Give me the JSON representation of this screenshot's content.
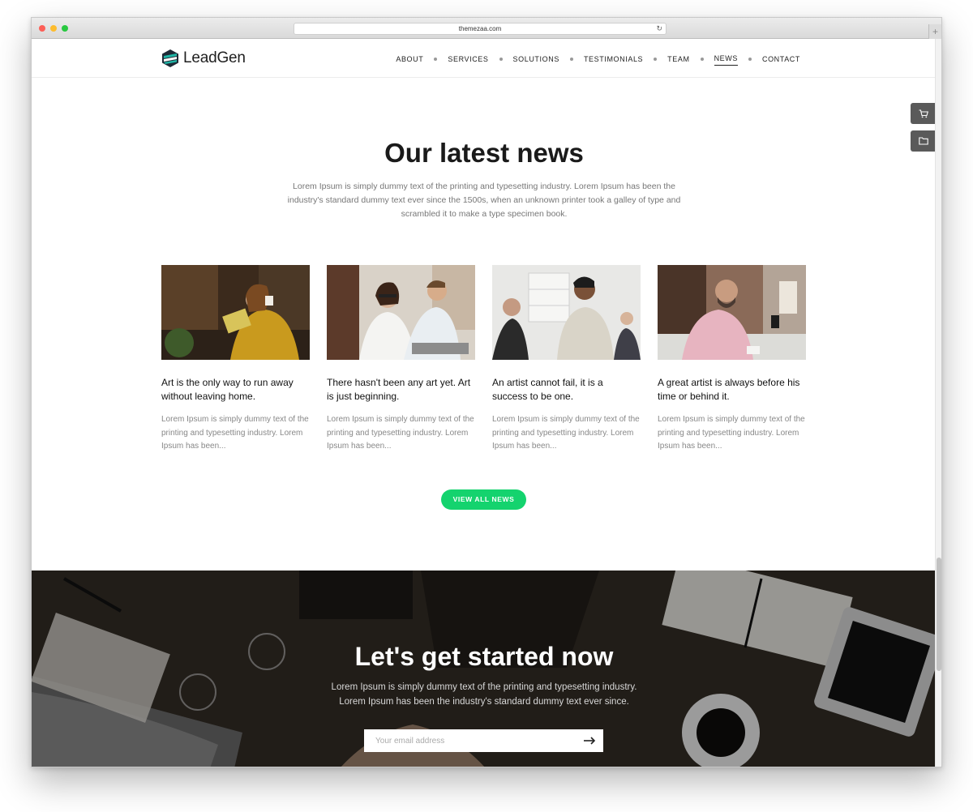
{
  "browser": {
    "url": "themezaa.com"
  },
  "nav": {
    "logo_text": "LeadGen",
    "items": [
      {
        "label": "ABOUT"
      },
      {
        "label": "SERVICES"
      },
      {
        "label": "SOLUTIONS"
      },
      {
        "label": "TESTIMONIALS"
      },
      {
        "label": "TEAM"
      },
      {
        "label": "NEWS"
      },
      {
        "label": "CONTACT"
      }
    ],
    "active_item": "NEWS"
  },
  "side_widget": {
    "icons": [
      "cart-icon",
      "folder-icon"
    ]
  },
  "news": {
    "title": "Our latest news",
    "intro": "Lorem Ipsum is simply dummy text of the printing and typesetting industry. Lorem Ipsum has been the industry's standard dummy text ever since the 1500s, when an unknown printer took a galley of type and scrambled it to make a type specimen book.",
    "cards": [
      {
        "title": "Art is the only way to run away without leaving home.",
        "excerpt": "Lorem Ipsum is simply dummy text of the printing and typesetting industry. Lorem Ipsum has been..."
      },
      {
        "title": "There hasn't been any art yet. Art is just beginning.",
        "excerpt": "Lorem Ipsum is simply dummy text of the printing and typesetting industry. Lorem Ipsum has been..."
      },
      {
        "title": "An artist cannot fail, it is a success to be one.",
        "excerpt": "Lorem Ipsum is simply dummy text of the printing and typesetting industry. Lorem Ipsum has been..."
      },
      {
        "title": "A great artist is always before his time or behind it.",
        "excerpt": "Lorem Ipsum is simply dummy text of the printing and typesetting industry. Lorem Ipsum has been..."
      }
    ],
    "button_label": "VIEW ALL NEWS"
  },
  "cta": {
    "title": "Let's get started now",
    "text_line1": "Lorem Ipsum is simply dummy text of the printing and typesetting industry.",
    "text_line2": "Lorem Ipsum has been the industry's standard dummy text ever since.",
    "email_placeholder": "Your email address"
  },
  "colors": {
    "accent": "#14d36e",
    "logo_teal": "#1fb6a6",
    "logo_dark": "#1f2a36"
  }
}
